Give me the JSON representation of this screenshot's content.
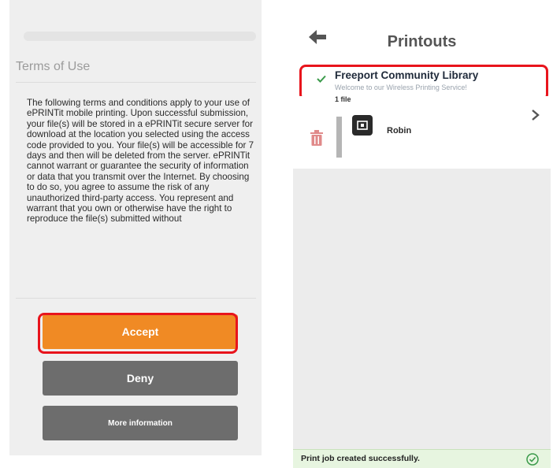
{
  "left_panel": {
    "title": "Terms of Use",
    "body": "The following terms and conditions apply to your use of ePRINTit mobile printing. Upon successful submission, your file(s) will be stored in a ePRINTit secure server for download at the location you selected using the access code provided to you. Your file(s) will be accessible for 7 days and then will be deleted from the server. ePRINTit cannot warrant or guarantee the security of information or data that you transmit over the Internet. By choosing to do so, you agree to assume the risk of any unauthorized third-party access. You represent and warrant that you own or otherwise have the right to reproduce the file(s) submitted without",
    "accept_label": "Accept",
    "deny_label": "Deny",
    "more_label": "More information"
  },
  "right_panel": {
    "title": "Printouts",
    "location": {
      "name": "Freeport Community Library",
      "subtitle": "Welcome to our Wireless Printing Service!"
    },
    "file_count": "1 file",
    "job_name": "Robin",
    "status": "Print job created successfully."
  },
  "colors": {
    "accent": "#f08a24",
    "button_gray": "#6d6d6d",
    "highlight": "#e8141c",
    "success": "#3a9a4a"
  },
  "icons": [
    "back-arrow-icon",
    "check-icon",
    "trash-icon",
    "document-icon",
    "chevron-right-icon",
    "success-check-circle-icon"
  ]
}
